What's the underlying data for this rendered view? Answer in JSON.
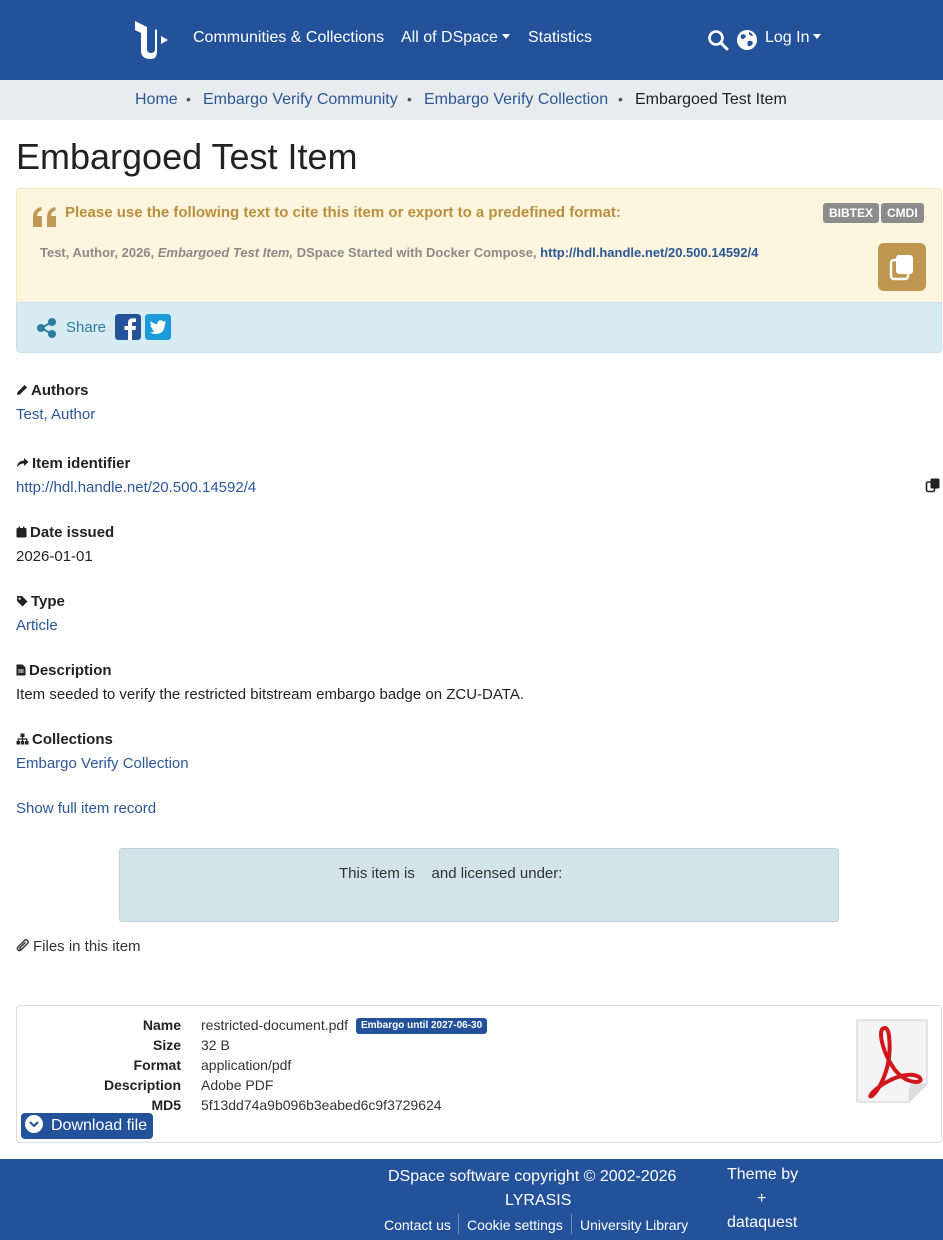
{
  "header": {
    "nav": {
      "communities": "Communities & Collections",
      "all_dspace": "All of DSpace",
      "statistics": "Statistics",
      "login": "Log In"
    },
    "icons": [
      "dspace-logo",
      "search-icon",
      "globe-icon"
    ]
  },
  "breadcrumb": {
    "items": [
      "Home",
      "Embargo Verify Community",
      "Embargo Verify Collection"
    ],
    "current": "Embargoed Test Item"
  },
  "item": {
    "title": "Embargoed Test Item",
    "citation": {
      "heading": "Please use the following text to cite this item or export to a predefined format:",
      "formats": [
        "BIBTEX",
        "CMDI"
      ],
      "text_prefix": "Test, Author, 2026, ",
      "text_title": "Embargoed Test Item,",
      "text_suffix": " DSpace Started with Docker Compose, ",
      "handle_link": "http://hdl.handle.net/20.500.14592/4"
    },
    "share": {
      "label": "Share"
    },
    "fields": {
      "authors_label": "Authors",
      "authors_value": "Test, Author",
      "identifier_label": "Item identifier",
      "identifier_value": "http://hdl.handle.net/20.500.14592/4",
      "date_label": "Date issued",
      "date_value": "2026-01-01",
      "type_label": "Type",
      "type_value": "Article",
      "description_label": "Description",
      "description_value": "Item seeded to verify the restricted bitstream embargo badge on ZCU-DATA.",
      "collections_label": "Collections",
      "collections_value": "Embargo Verify Collection"
    },
    "show_full": "Show full item record",
    "license_text": "This item is    and licensed under:",
    "files_label": "Files in this item",
    "file": {
      "name_key": "Name",
      "name": "restricted-document.pdf",
      "embargo_badge": "Embargo until 2027-06-30",
      "size_key": "Size",
      "size": "32 B",
      "format_key": "Format",
      "format": "application/pdf",
      "description_key": "Description",
      "description": "Adobe PDF",
      "md5_key": "MD5",
      "md5": "5f13dd74a9b096b3eabed6c9f3729624",
      "download": "Download file"
    }
  },
  "footer": {
    "copyright_line1": "DSpace software copyright © 2002-2026",
    "copyright_line2": "LYRASIS",
    "links": [
      "Contact us",
      "Cookie settings",
      "University Library"
    ],
    "theme_line1": "Theme by",
    "theme_line2": "+",
    "theme_line3": "dataquest"
  },
  "colors": {
    "primary": "#23529a",
    "citation_bg": "#fdf5dd",
    "share_bg": "#d7ebf3",
    "license_bg": "#d3e3ea",
    "copy_button": "#be9650"
  }
}
